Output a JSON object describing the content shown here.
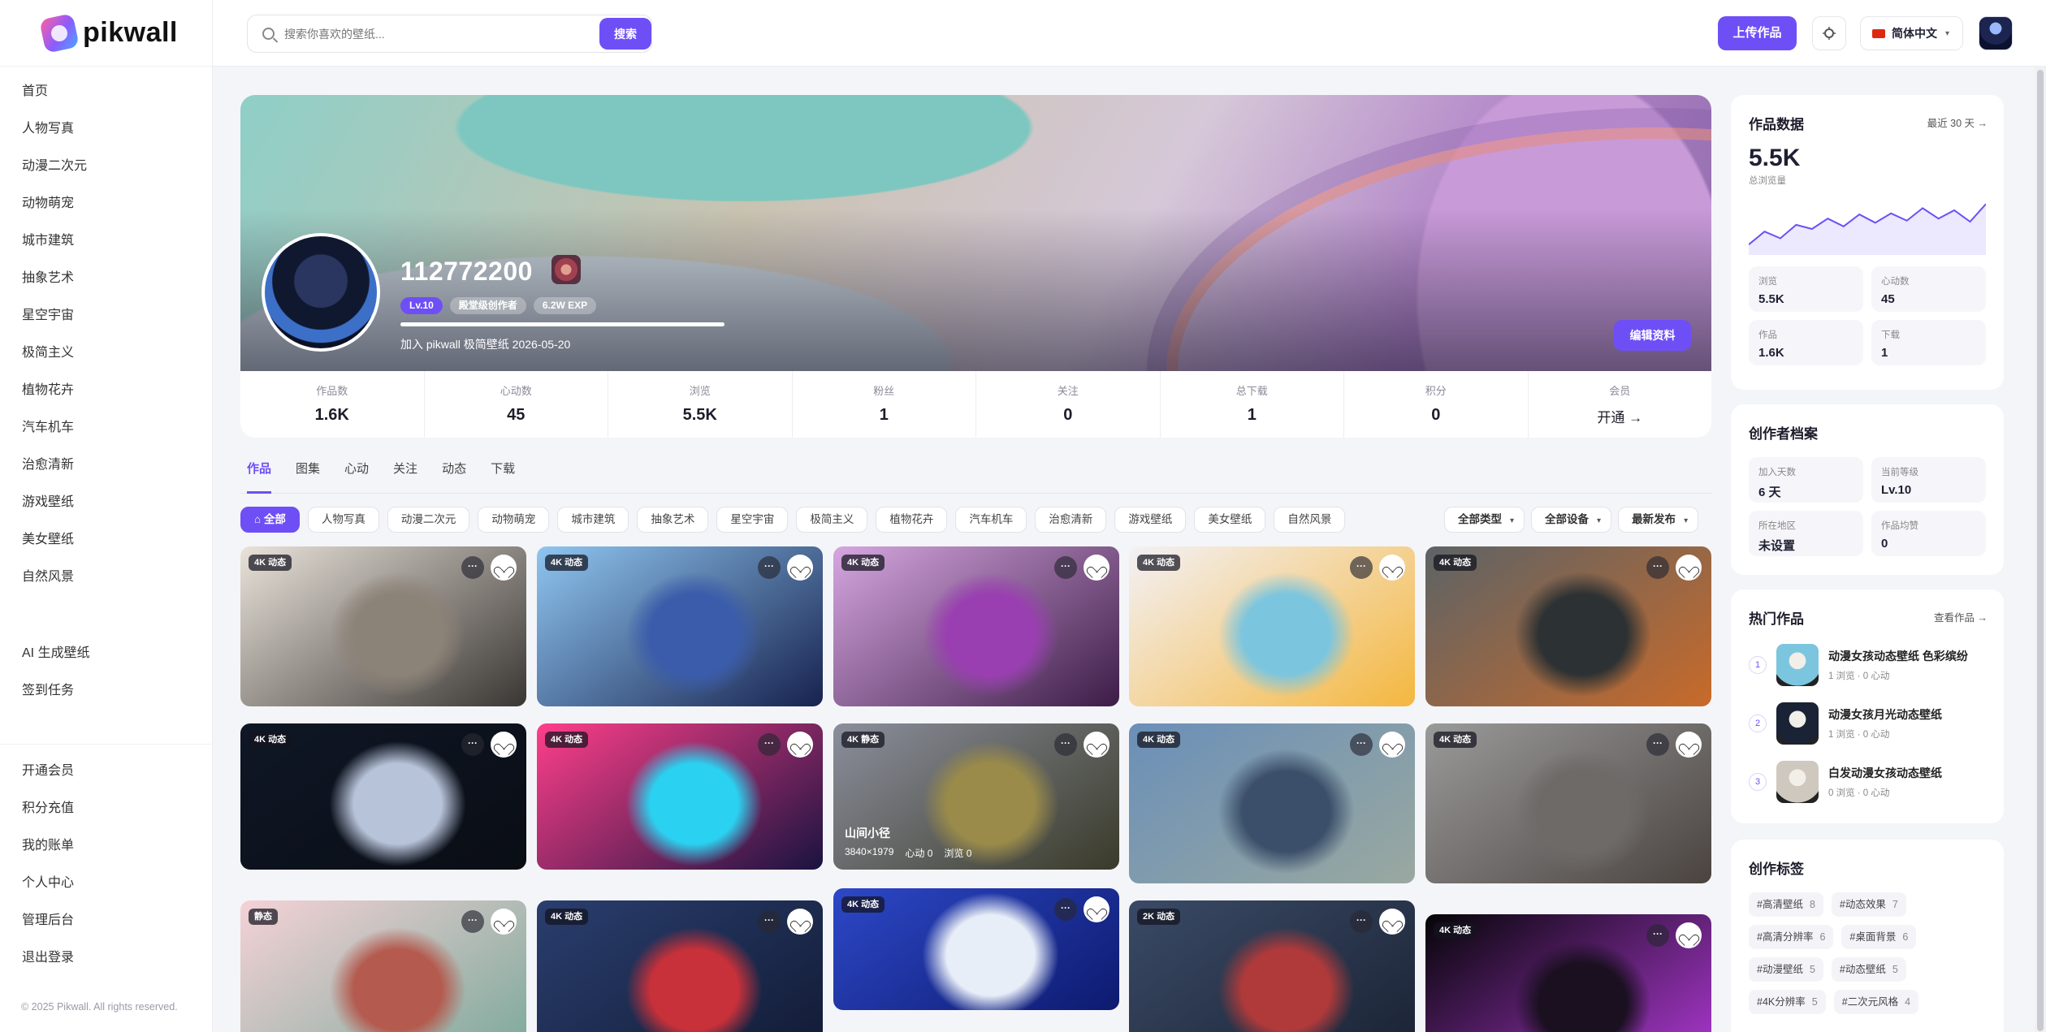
{
  "app": {
    "logo_text": "pikwall"
  },
  "sidebar": {
    "items": [
      "首页",
      "人物写真",
      "动漫二次元",
      "动物萌宠",
      "城市建筑",
      "抽象艺术",
      "星空宇宙",
      "极简主义",
      "植物花卉",
      "汽车机车",
      "治愈清新",
      "游戏壁纸",
      "美女壁纸",
      "自然风景"
    ],
    "extra": [
      "AI 生成壁纸",
      "签到任务"
    ],
    "account": [
      "开通会员",
      "积分充值",
      "我的账单",
      "个人中心",
      "管理后台",
      "退出登录"
    ],
    "copyright": "© 2025 Pikwall. All rights reserved."
  },
  "header": {
    "search_placeholder": "搜索你喜欢的壁纸...",
    "search_label": "搜索",
    "upload_label": "上传作品",
    "language": "简体中文"
  },
  "profile": {
    "name": "112772200",
    "level": "Lv.10",
    "title": "殿堂级创作者",
    "exp": "6.2W EXP",
    "exp_progress": 1.0,
    "joined": "加入 pikwall 极简壁纸 2026-05-20",
    "edit_label": "编辑资料"
  },
  "stats": [
    {
      "label": "作品数",
      "value": "1.6K"
    },
    {
      "label": "心动数",
      "value": "45"
    },
    {
      "label": "浏览",
      "value": "5.5K"
    },
    {
      "label": "粉丝",
      "value": "1"
    },
    {
      "label": "关注",
      "value": "0"
    },
    {
      "label": "总下载",
      "value": "1"
    },
    {
      "label": "积分",
      "value": "0"
    },
    {
      "label": "会员",
      "value": "开通 →"
    }
  ],
  "tabs": [
    "作品",
    "图集",
    "心动",
    "关注",
    "动态",
    "下载"
  ],
  "filters": {
    "chips": [
      "全部",
      "人物写真",
      "动漫二次元",
      "动物萌宠",
      "城市建筑",
      "抽象艺术",
      "星空宇宙",
      "极简主义",
      "植物花卉",
      "汽车机车",
      "治愈清新",
      "游戏壁纸",
      "美女壁纸",
      "自然风景"
    ],
    "selects": [
      "全部类型",
      "全部设备",
      "最新发布"
    ]
  },
  "cards": [
    {
      "badge": "4K 动态",
      "colors": [
        "#e9e3da",
        "#8c8378",
        "#3a3633"
      ]
    },
    {
      "badge": "4K 动态",
      "colors": [
        "#8fc6f1",
        "#3a5cab",
        "#17224f"
      ]
    },
    {
      "badge": "4K 动态",
      "colors": [
        "#d6a6e0",
        "#9a3fb1",
        "#3c1d47"
      ]
    },
    {
      "badge": "4K 动态",
      "colors": [
        "#f3f1f6",
        "#7cc5de",
        "#f4b73f"
      ]
    },
    {
      "badge": "4K 动态",
      "colors": [
        "#5c6366",
        "#2c3133",
        "#c86a2a"
      ]
    },
    {
      "badge": "4K 动态",
      "colors": [
        "#0f1726",
        "#b7c3d9",
        "#0a0d14"
      ]
    },
    {
      "badge": "4K 动态",
      "colors": [
        "#ff3f8a",
        "#2bd1f0",
        "#1a1340"
      ]
    },
    {
      "badge": "4K 静态",
      "colors": [
        "#8b8f9c",
        "#9a8b4a",
        "#3a3a2a"
      ],
      "title": "山间小径",
      "res": "3840×1979",
      "likes": "心动 0",
      "views": "浏览 0"
    },
    {
      "badge": "4K 动态",
      "colors": [
        "#6a8fb8",
        "#3c4f6a",
        "#9aa9a0"
      ]
    },
    {
      "badge": "4K 动态",
      "colors": [
        "#9a9a9a",
        "#6e6a68",
        "#4a4340"
      ]
    },
    {
      "badge": "静态",
      "colors": [
        "#f5d2d6",
        "#b45a4e",
        "#7aa89a"
      ]
    },
    {
      "badge": "4K 动态",
      "colors": [
        "#2a3e6e",
        "#c8313a",
        "#111a33"
      ]
    },
    {
      "badge": "4K 动态",
      "colors": [
        "#2d48c8",
        "#e8eef8",
        "#0d1a6e"
      ]
    },
    {
      "badge": "2K 动态",
      "colors": [
        "#3a4a66",
        "#b03a3a",
        "#1a2233"
      ]
    },
    {
      "badge": "4K 动态",
      "colors": [
        "#050507",
        "#1a1020",
        "#b23ad8"
      ]
    }
  ],
  "work_data": {
    "title": "作品数据",
    "range_link": "最近 30 天 →",
    "total_views": "5.5K",
    "total_views_label": "总浏览量",
    "trend": [
      20,
      45,
      32,
      58,
      50,
      70,
      55,
      78,
      62,
      80,
      66,
      90,
      70,
      86,
      64,
      98
    ],
    "metrics": [
      {
        "label": "浏览",
        "value": "5.5K"
      },
      {
        "label": "心动数",
        "value": "45"
      },
      {
        "label": "作品",
        "value": "1.6K"
      },
      {
        "label": "下载",
        "value": "1"
      }
    ]
  },
  "creator_profile": {
    "title": "创作者档案",
    "metrics": [
      {
        "label": "加入天数",
        "value": "6 天"
      },
      {
        "label": "当前等级",
        "value": "Lv.10"
      },
      {
        "label": "所在地区",
        "value": "未设置"
      },
      {
        "label": "作品均赞",
        "value": "0"
      }
    ]
  },
  "hot_works": {
    "title": "热门作品",
    "link": "查看作品 →",
    "items": [
      {
        "rank": "1",
        "title": "动漫女孩动态壁纸 色彩缤纷",
        "meta": "1 浏览 · 0 心动",
        "color": "#7cc5de"
      },
      {
        "rank": "2",
        "title": "动漫女孩月光动态壁纸",
        "meta": "1 浏览 · 0 心动",
        "color": "#1a2235"
      },
      {
        "rank": "3",
        "title": "白发动漫女孩动态壁纸",
        "meta": "0 浏览 · 0 心动",
        "color": "#cfc8bf"
      }
    ]
  },
  "tags": {
    "title": "创作标签",
    "items": [
      {
        "name": "#高清壁纸",
        "count": "8"
      },
      {
        "name": "#动态效果",
        "count": "7"
      },
      {
        "name": "#高清分辨率",
        "count": "6"
      },
      {
        "name": "#桌面背景",
        "count": "6"
      },
      {
        "name": "#动漫壁纸",
        "count": "5"
      },
      {
        "name": "#动态壁纸",
        "count": "5"
      },
      {
        "name": "#4K分辨率",
        "count": "5"
      },
      {
        "name": "#二次元风格",
        "count": "4"
      }
    ]
  }
}
